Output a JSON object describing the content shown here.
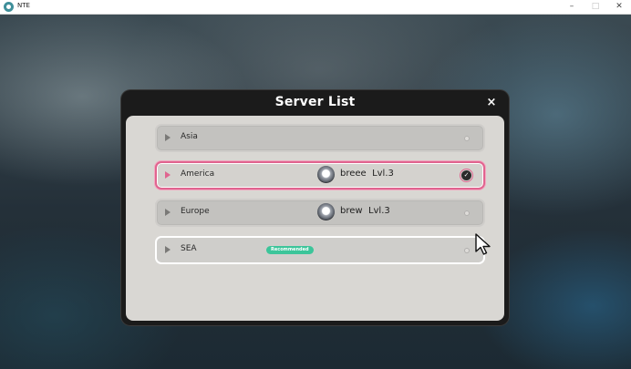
{
  "window": {
    "title": "NTE",
    "controls": {
      "minimize": "–",
      "maximize": "□",
      "close": "✕"
    }
  },
  "dialog": {
    "title": "Server List",
    "close_label": "×",
    "servers": [
      {
        "name": "Asia",
        "state": "default",
        "character": null,
        "badge": null
      },
      {
        "name": "America",
        "state": "selected",
        "character": {
          "name": "breee",
          "level": "Lvl.3"
        },
        "badge": null
      },
      {
        "name": "Europe",
        "state": "default",
        "character": {
          "name": "brew",
          "level": "Lvl.3"
        },
        "badge": null
      },
      {
        "name": "SEA",
        "state": "hover",
        "character": null,
        "badge": "Recommended"
      }
    ]
  },
  "colors": {
    "accent_pink": "#e0648f",
    "recommended_green": "#3cc59a",
    "panel_bg": "#d9d7d3",
    "dialog_frame": "#1b1b1b"
  },
  "icons": {
    "row_indicator": "play-triangle-icon",
    "selected": "check-circle-icon",
    "character": "character-avatar-icon",
    "pointer": "mouse-cursor-icon"
  }
}
